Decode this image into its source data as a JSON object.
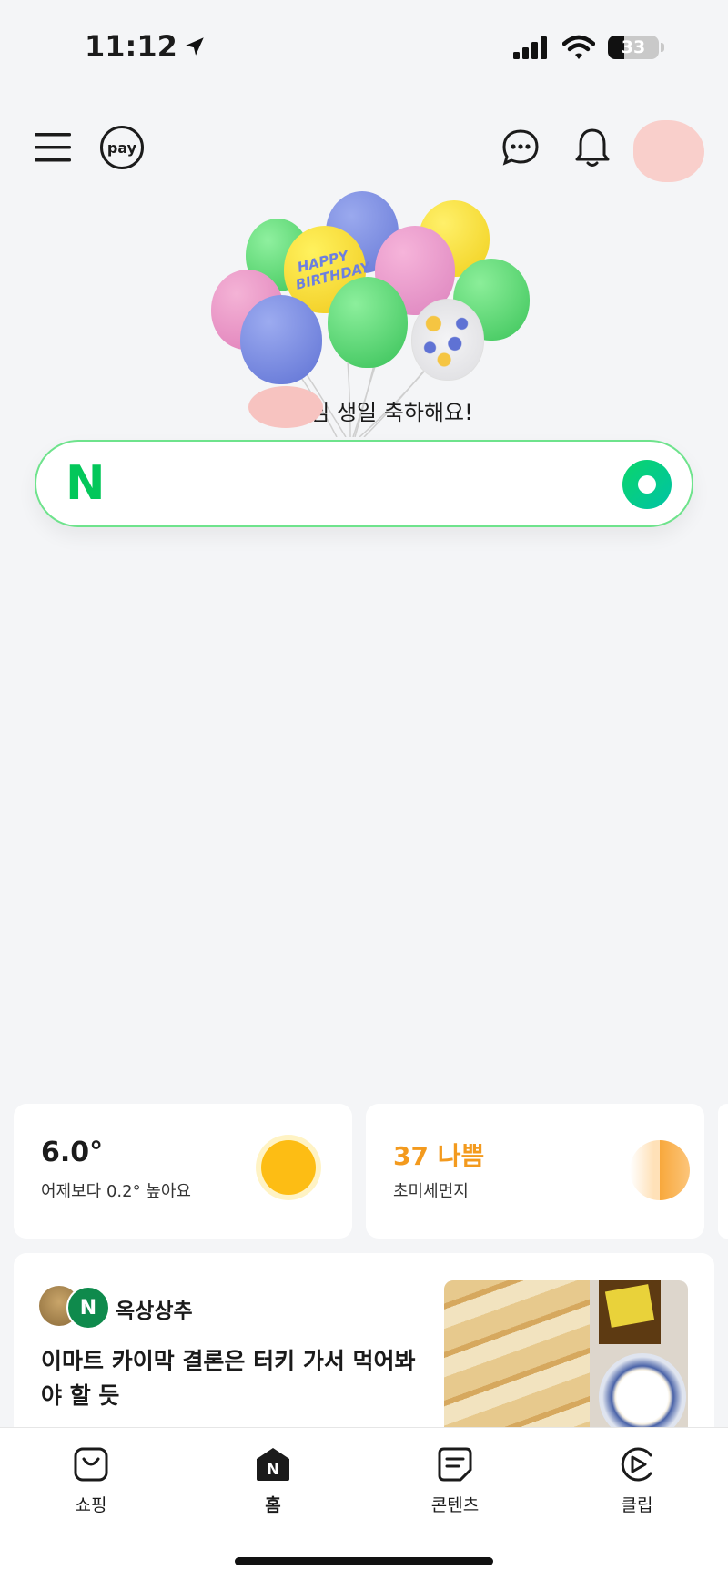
{
  "status_bar": {
    "time": "11:12",
    "battery": "33"
  },
  "header": {
    "pay_label": "pay"
  },
  "greeting": {
    "text": "님 생일 축하해요!",
    "balloon_text": "HAPPY BIRTHDAY"
  },
  "search": {
    "logo": "N"
  },
  "weather": {
    "temperature": "6.0°",
    "comparison": "어제보다 0.2° 높아요"
  },
  "dust": {
    "value": "37 나쁨",
    "label": "초미세먼지"
  },
  "feed": {
    "author": "옥상상추",
    "title_line1": "이마트 카이막 결론은 터키 가서 먹어봐",
    "title_line2": "야 할 듯"
  },
  "tabs": [
    {
      "label": "쇼핑",
      "icon": "shopping-bag-icon"
    },
    {
      "label": "홈",
      "icon": "home-n-icon"
    },
    {
      "label": "콘텐츠",
      "icon": "contents-icon"
    },
    {
      "label": "클립",
      "icon": "clip-play-icon"
    }
  ],
  "colors": {
    "brand_green": "#03c75a",
    "dust_orange": "#f39a1e",
    "sun_yellow": "#fdbd14"
  }
}
